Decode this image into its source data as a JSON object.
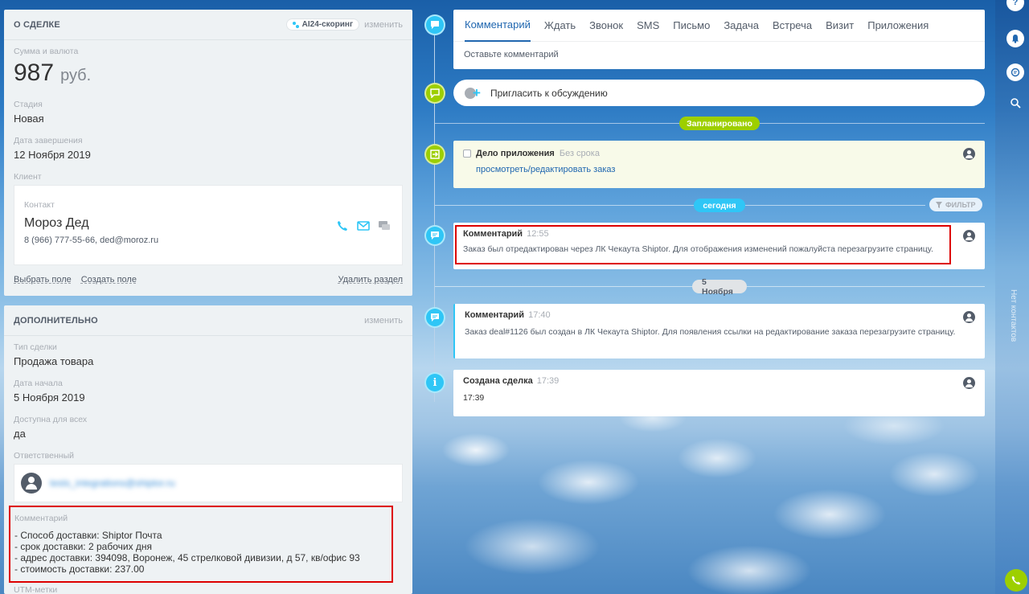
{
  "deal_card": {
    "title": "О СДЕЛКЕ",
    "ai_badge": "AI24-скоринг",
    "edit": "изменить",
    "sum_label": "Сумма и валюта",
    "sum_amount": "987",
    "sum_currency": "руб.",
    "stage_label": "Стадия",
    "stage_value": "Новая",
    "close_date_label": "Дата завершения",
    "close_date_value": "12 Ноября 2019",
    "client_label": "Клиент",
    "contact_label": "Контакт",
    "contact_name": "Мороз Дед",
    "contact_meta": "8 (966) 777-55-66, ded@moroz.ru",
    "footer_select": "Выбрать поле",
    "footer_create": "Создать поле",
    "footer_delete": "Удалить раздел"
  },
  "extra_card": {
    "title": "ДОПОЛНИТЕЛЬНО",
    "edit": "изменить",
    "type_label": "Тип сделки",
    "type_value": "Продажа товара",
    "start_label": "Дата начала",
    "start_value": "5 Ноября 2019",
    "public_label": "Доступна для всех",
    "public_value": "да",
    "resp_label": "Ответственный",
    "resp_value": "tests_integrations@shiptor.ru",
    "comment_label": "Комментарий",
    "comment_lines": [
      "- Способ доставки: Shiptor Почта",
      "- срок доставки: 2 рабочих дня",
      "- адрес доставки: 394098, Воронеж, 45 стрелковой дивизии, д 57, кв/офис 93",
      "- стоимость доставки: 237.00"
    ],
    "utm_label": "UTM-метки"
  },
  "editor": {
    "tabs": [
      "Комментарий",
      "Ждать",
      "Звонок",
      "SMS",
      "Письмо",
      "Задача",
      "Встреча",
      "Визит",
      "Приложения"
    ],
    "placeholder": "Оставьте комментарий"
  },
  "invite": {
    "label": "Пригласить к обсуждению"
  },
  "dividers": {
    "planned": "Запланировано",
    "today": "сегодня",
    "date": "5 Ноября",
    "filter": "ФИЛЬТР"
  },
  "task": {
    "title": "Дело приложения",
    "term": "Без срока",
    "link": "просмотреть/редактировать заказ"
  },
  "entries": [
    {
      "title": "Комментарий",
      "time": "12:55",
      "text": "Заказ был отредактирован через ЛК Чекаута Shiptor. Для отображения изменений пожалуйста перезагрузите страницу."
    },
    {
      "title": "Комментарий",
      "time": "17:40",
      "text": "Заказ deal#1126 был создан в ЛК Чекаута Shiptor. Для появления ссылки на редактирование заказа перезагрузите страницу."
    },
    {
      "title": "Создана сделка",
      "time": "17:39",
      "text": "17:39"
    }
  ],
  "rail": {
    "label": "Нет контактов"
  },
  "colors": {
    "accent": "#2067b0",
    "cyan": "#2fc6f6",
    "green": "#9dcf00",
    "highlight": "#dd0000"
  }
}
